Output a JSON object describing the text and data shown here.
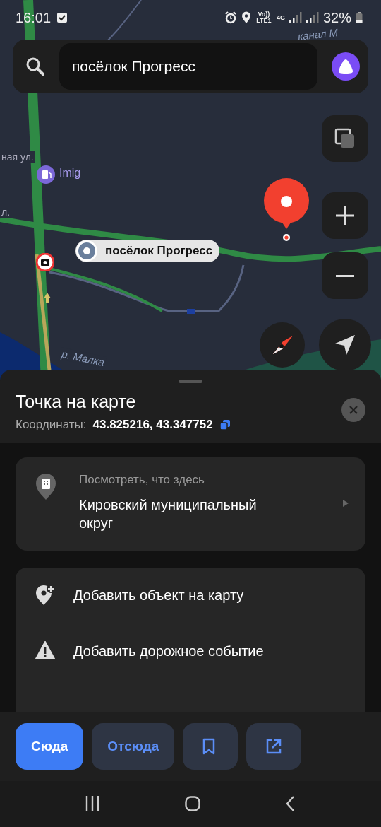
{
  "status_bar": {
    "time": "16:01",
    "network": "Vo)) LTE1",
    "data_type": "4G",
    "battery": "32%"
  },
  "search": {
    "value": "посёлок Прогресс"
  },
  "map": {
    "labels": [
      {
        "text": "канал М",
        "kind": "water"
      },
      {
        "text": "ная ул.",
        "kind": "street"
      },
      {
        "text": "л.",
        "kind": "street"
      },
      {
        "text": "р. Малка",
        "kind": "water"
      }
    ],
    "poi": {
      "name": "Imig"
    },
    "place_label": "посёлок Прогресс"
  },
  "sheet": {
    "title": "Точка на карте",
    "coordinates_label": "Координаты:",
    "coordinates": "43.825216, 43.347752",
    "info_card": {
      "caption": "Посмотреть, что здесь",
      "value": "Кировский муниципальный округ"
    },
    "actions": [
      {
        "label": "Добавить объект на карту",
        "kind": "add-place"
      },
      {
        "label": "Добавить дорожное событие",
        "kind": "road-event"
      }
    ]
  },
  "buttons": [
    {
      "kind": "text",
      "label": "Сюда",
      "primary": true
    },
    {
      "kind": "text",
      "label": "Отсюда",
      "primary": false
    },
    {
      "kind": "bookmark",
      "primary": false
    },
    {
      "kind": "share",
      "primary": false
    }
  ]
}
